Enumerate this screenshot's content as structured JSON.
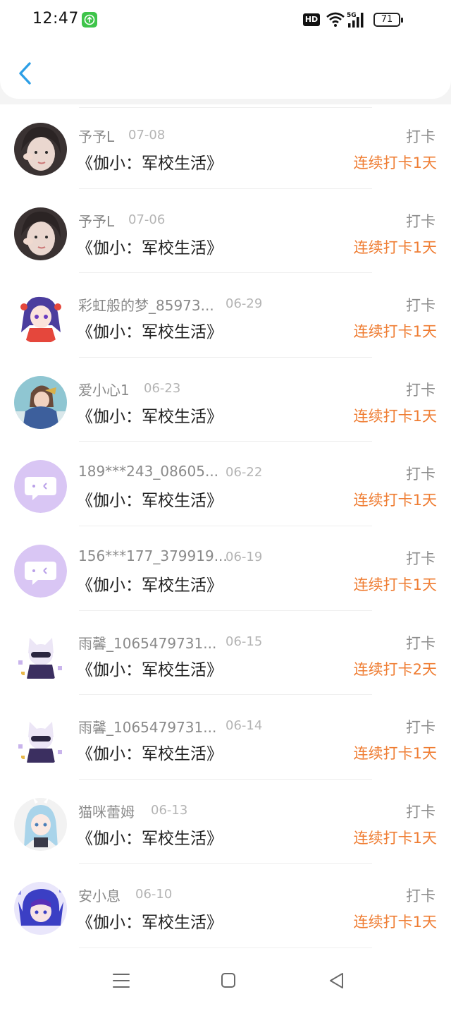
{
  "status_bar": {
    "time": "12:47",
    "hd_label": "HD",
    "network_label": "5G",
    "battery": "71"
  },
  "header": {
    "back_icon": "chevron-left-icon"
  },
  "items": [
    {
      "username": "予予L",
      "date": "07-08",
      "book": "《伽小：军校生活》",
      "action": "打卡",
      "streak": "连续打卡1天"
    },
    {
      "username": "予予L",
      "date": "07-06",
      "book": "《伽小：军校生活》",
      "action": "打卡",
      "streak": "连续打卡1天"
    },
    {
      "username": "彩虹般的梦_85973...",
      "date": "06-29",
      "book": "《伽小：军校生活》",
      "action": "打卡",
      "streak": "连续打卡1天"
    },
    {
      "username": "爱小心1",
      "date": "06-23",
      "book": "《伽小：军校生活》",
      "action": "打卡",
      "streak": "连续打卡1天"
    },
    {
      "username": "189***243_08605...",
      "date": "06-22",
      "book": "《伽小：军校生活》",
      "action": "打卡",
      "streak": "连续打卡1天"
    },
    {
      "username": "156***177_379919...",
      "date": "06-19",
      "book": "《伽小：军校生活》",
      "action": "打卡",
      "streak": "连续打卡1天"
    },
    {
      "username": "雨馨_1065479731...",
      "date": "06-15",
      "book": "《伽小：军校生活》",
      "action": "打卡",
      "streak": "连续打卡2天"
    },
    {
      "username": "雨馨_1065479731...",
      "date": "06-14",
      "book": "《伽小：军校生活》",
      "action": "打卡",
      "streak": "连续打卡1天"
    },
    {
      "username": "猫咪蕾姆",
      "date": "06-13",
      "book": "《伽小：军校生活》",
      "action": "打卡",
      "streak": "连续打卡1天"
    },
    {
      "username": "安小息",
      "date": "06-10",
      "book": "《伽小：军校生活》",
      "action": "打卡",
      "streak": "连续打卡1天"
    }
  ],
  "colors": {
    "accent_orange": "#ef7d33",
    "back_blue": "#2d9fe6",
    "default_avatar_purple": "#d9c6f4"
  },
  "bottom_nav": {
    "icons": [
      "menu-icon",
      "home-square-icon",
      "back-triangle-icon"
    ]
  }
}
